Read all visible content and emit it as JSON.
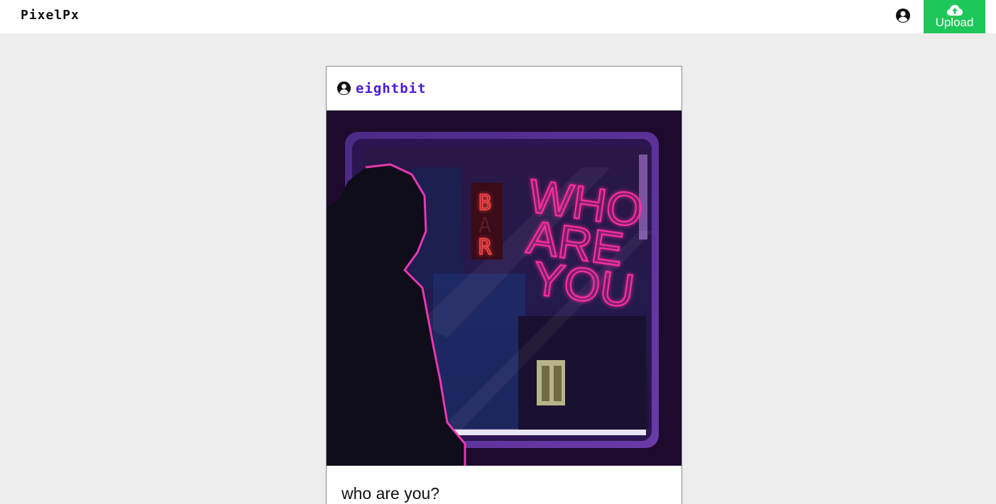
{
  "app": {
    "brand": "PixelPx"
  },
  "header": {
    "account_icon": "user-circle-icon",
    "upload_icon": "cloud-upload-icon",
    "upload_label": "Upload",
    "upload_color": "#1ec75a"
  },
  "post": {
    "author_icon": "user-circle-icon",
    "author": "eightbit",
    "author_color": "#4a1ad8",
    "image_text": {
      "sign_bar": "BAR",
      "sign_neon": [
        "WHO",
        "ARE",
        "YOU"
      ]
    },
    "caption": "who are you?"
  }
}
